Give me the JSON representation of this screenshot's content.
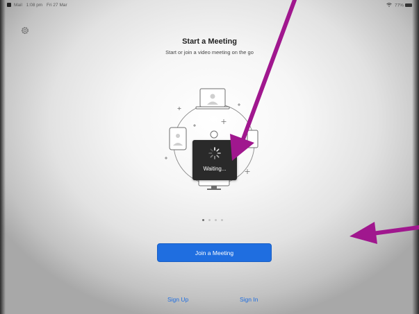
{
  "status_bar": {
    "back_label": "Mail",
    "time": "1:08 pm",
    "date": "Fri 27 Mar",
    "battery": "77%"
  },
  "header": {
    "title": "Start a Meeting",
    "subtitle": "Start or join a video meeting on the go"
  },
  "overlay": {
    "waiting_label": "Waiting..."
  },
  "pager": {
    "count": 4,
    "active_index": 0
  },
  "actions": {
    "join_label": "Join a Meeting",
    "sign_up_label": "Sign Up",
    "sign_in_label": "Sign In"
  },
  "colors": {
    "accent": "#1f6ee0",
    "annotation_arrow": "#a0178e",
    "hud": "#2a2a2a"
  },
  "icons": {
    "settings": "gear-icon",
    "battery": "battery-icon",
    "wifi": "wifi-icon"
  }
}
